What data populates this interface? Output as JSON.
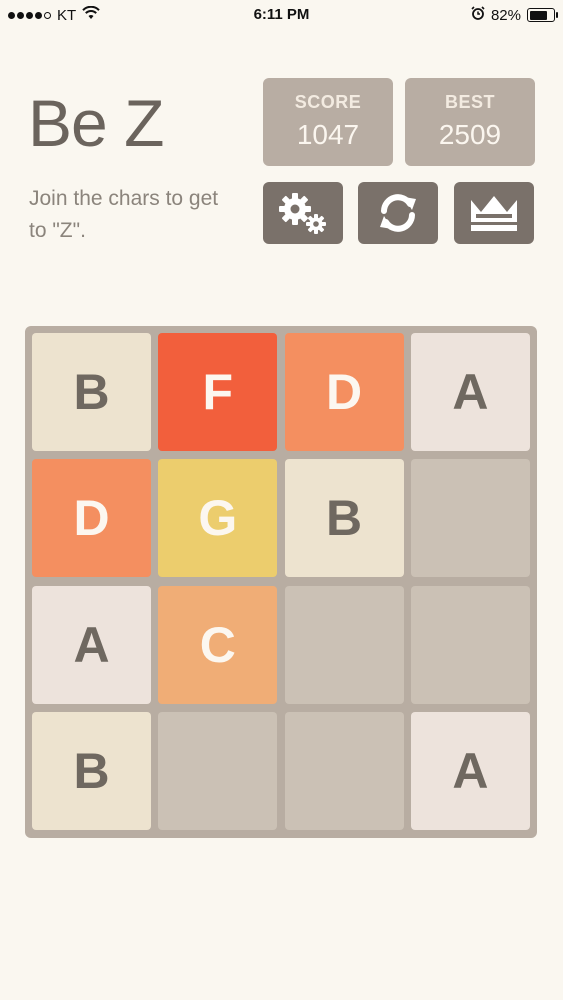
{
  "status_bar": {
    "carrier": "KT",
    "time": "6:11 PM",
    "battery_text": "82%",
    "battery_level": 0.82,
    "icons": [
      "signal-dots-icon",
      "wifi-icon",
      "alarm-icon",
      "battery-icon"
    ]
  },
  "header": {
    "title": "Be Z",
    "subtitle": "Join the chars to get to \"Z\"."
  },
  "score": {
    "label": "SCORE",
    "value": "1047"
  },
  "best": {
    "label": "BEST",
    "value": "2509"
  },
  "buttons": [
    {
      "name": "settings-button",
      "icon": "gears-icon"
    },
    {
      "name": "restart-button",
      "icon": "refresh-icon"
    },
    {
      "name": "leaderboard-button",
      "icon": "crown-icon"
    }
  ],
  "board": {
    "rows": [
      [
        {
          "letter": "B",
          "bg": "#ede3cf",
          "fg": "#6f6860"
        },
        {
          "letter": "F",
          "bg": "#f25f3c",
          "fg": "#fcf7f0"
        },
        {
          "letter": "D",
          "bg": "#f48f60",
          "fg": "#fcf7f0"
        },
        {
          "letter": "A",
          "bg": "#ede3dc",
          "fg": "#6f6860"
        }
      ],
      [
        {
          "letter": "D",
          "bg": "#f48f60",
          "fg": "#fcf7f0"
        },
        {
          "letter": "G",
          "bg": "#eccd6d",
          "fg": "#fcf7f0"
        },
        {
          "letter": "B",
          "bg": "#ede3cf",
          "fg": "#6f6860"
        },
        {
          "letter": "",
          "bg": "#cbc1b5",
          "fg": "#6f6860"
        }
      ],
      [
        {
          "letter": "A",
          "bg": "#ede3dc",
          "fg": "#6f6860"
        },
        {
          "letter": "C",
          "bg": "#f0ad76",
          "fg": "#fcf7f0"
        },
        {
          "letter": "",
          "bg": "#cbc1b5",
          "fg": "#6f6860"
        },
        {
          "letter": "",
          "bg": "#cbc1b5",
          "fg": "#6f6860"
        }
      ],
      [
        {
          "letter": "B",
          "bg": "#ede3cf",
          "fg": "#6f6860"
        },
        {
          "letter": "",
          "bg": "#cbc1b5",
          "fg": "#6f6860"
        },
        {
          "letter": "",
          "bg": "#cbc1b5",
          "fg": "#6f6860"
        },
        {
          "letter": "A",
          "bg": "#ede3dc",
          "fg": "#6f6860"
        }
      ]
    ]
  }
}
